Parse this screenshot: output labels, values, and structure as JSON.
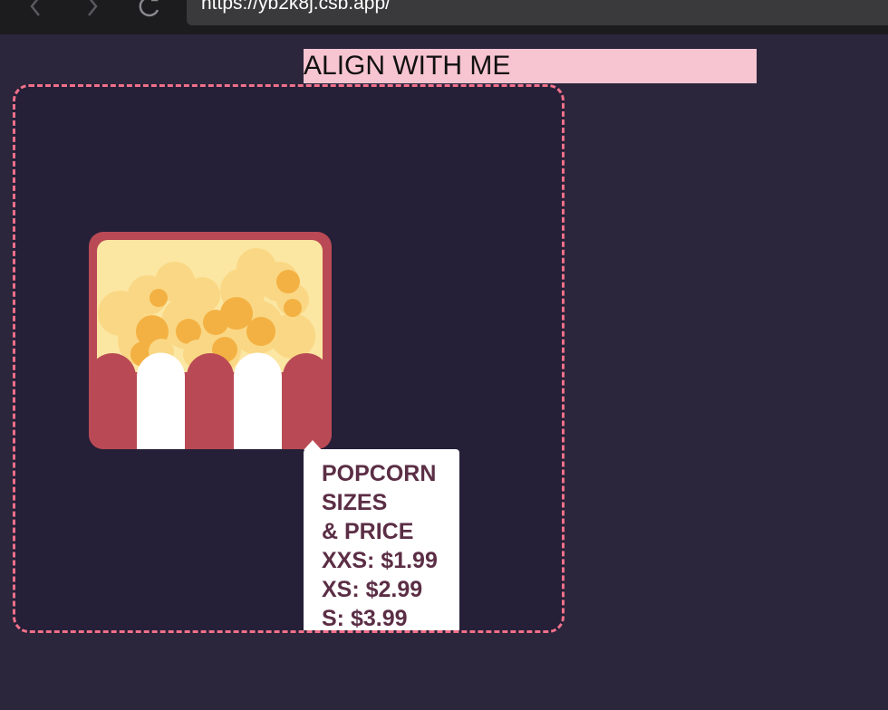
{
  "browser": {
    "url": "https://yb2k8j.csb.app/"
  },
  "page": {
    "align_label": "ALIGN WITH ME"
  },
  "tooltip": {
    "lines": [
      "POPCORN",
      "SIZES",
      "& PRICE",
      "XXS: $1.99",
      "XS: $2.99",
      "S: $3.99"
    ]
  },
  "colors": {
    "page_bg": "#2c263c",
    "frame_border": "#f0708a",
    "label_bg": "#f7c5d1",
    "popcorn_red": "#b94a55",
    "tooltip_text": "#5b2e45"
  },
  "icons": [
    "back-arrow-icon",
    "forward-arrow-icon",
    "reload-icon",
    "popcorn-icon"
  ]
}
